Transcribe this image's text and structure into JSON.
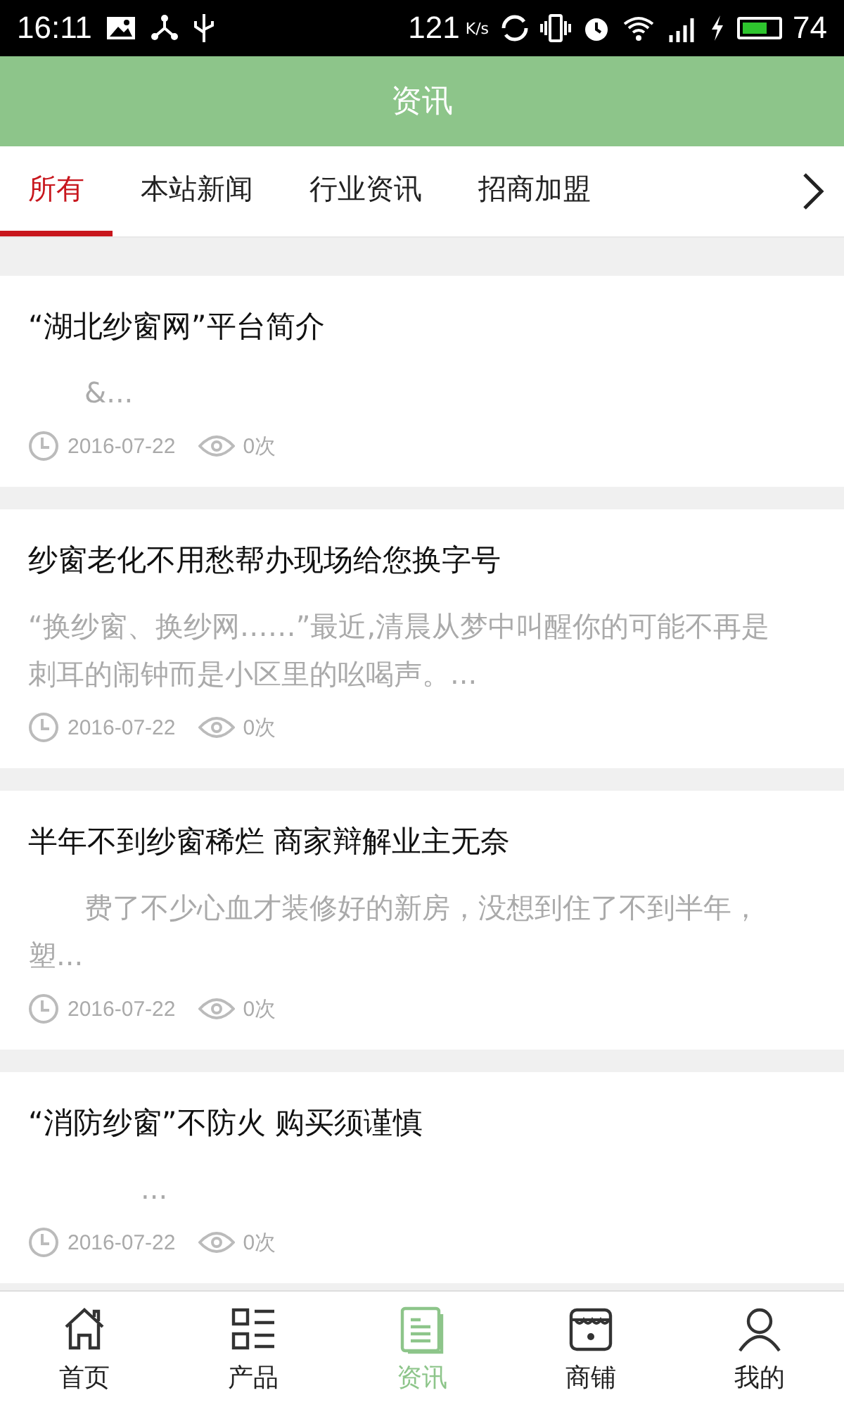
{
  "status_bar": {
    "time": "16:11",
    "speed": "121",
    "speed_unit": "K/s",
    "battery": "74"
  },
  "header": {
    "title": "资讯"
  },
  "tabs": [
    {
      "label": "所有",
      "selected": true
    },
    {
      "label": "本站新闻",
      "selected": false
    },
    {
      "label": "行业资讯",
      "selected": false
    },
    {
      "label": "招商加盟",
      "selected": false
    }
  ],
  "articles": [
    {
      "title": "“湖北纱窗网”平台简介",
      "summary": "　　&...",
      "date": "2016-07-22",
      "views": "0次"
    },
    {
      "title": "纱窗老化不用愁帮办现场给您换字号",
      "summary": "“换纱窗、换纱网……”最近,清晨从梦中叫醒你的可能不再是刺耳的闹钟而是小区里的吆喝声。...",
      "date": "2016-07-22",
      "views": "0次"
    },
    {
      "title": "半年不到纱窗稀烂 商家辩解业主无奈",
      "summary": "　　费了不少心血才装修好的新房，没想到住了不到半年，塑...",
      "date": "2016-07-22",
      "views": "0次"
    },
    {
      "title": "“消防纱窗”不防火 购买须谨慎",
      "summary": "　　　　...",
      "date": "2016-07-22",
      "views": "0次"
    }
  ],
  "bottom_nav": [
    {
      "kind": "home",
      "label": "首页",
      "selected": false
    },
    {
      "kind": "products",
      "label": "产品",
      "selected": false
    },
    {
      "kind": "news",
      "label": "资讯",
      "selected": true
    },
    {
      "kind": "shop",
      "label": "商铺",
      "selected": false
    },
    {
      "kind": "profile",
      "label": "我的",
      "selected": false
    }
  ]
}
